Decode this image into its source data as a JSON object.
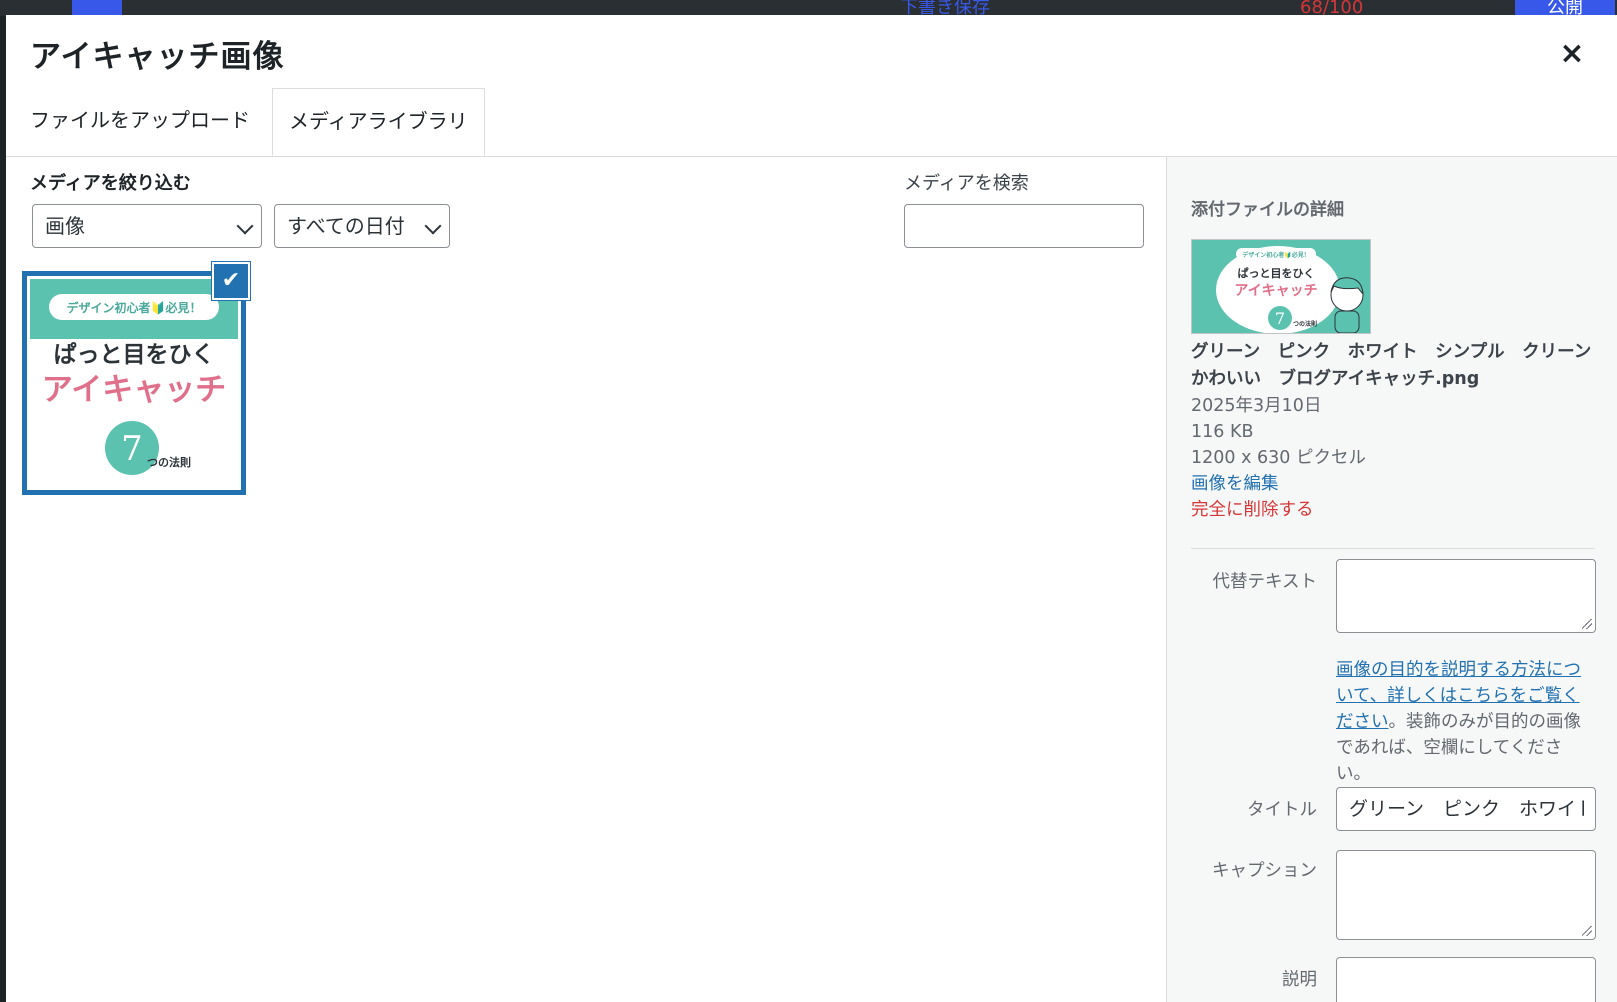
{
  "background": {
    "draft_label": "下書き保存",
    "score_label": "68/100",
    "publish_label": "公開"
  },
  "modal": {
    "title": "アイキャッチ画像",
    "close_label": "×"
  },
  "tabs": {
    "upload": "ファイルをアップロード",
    "library": "メディアライブラリ"
  },
  "filters": {
    "label": "メディアを絞り込む",
    "type_value": "画像",
    "date_value": "すべての日付",
    "search_label": "メディアを検索",
    "search_value": ""
  },
  "attachment": {
    "banner": "デザイン初心者🔰必見！",
    "line1": "ぱっと目をひく",
    "line2": "アイキャッチ",
    "number": "7",
    "suffix": "つの法則",
    "selected": true
  },
  "details": {
    "heading": "添付ファイルの詳細",
    "filename": "グリーン　ピンク　ホワイト　シンプル　クリーン　かわいい　ブログアイキャッチ.png",
    "date": "2025年3月10日",
    "size": "116 KB",
    "dimensions": "1200 x 630 ピクセル",
    "edit_link": "画像を編集",
    "delete_link": "完全に削除する"
  },
  "fields": {
    "alt_label": "代替テキスト",
    "alt_value": "",
    "alt_help_link": "画像の目的を説明する方法について、詳しくはこちらをご覧ください",
    "alt_help_text": "。装飾のみが目的の画像であれば、空欄にしてください。",
    "title_label": "タイトル",
    "title_value": "グリーン　ピンク　ホワイト　シンプル　クリーン　かわいい　ブログアイキャッチ",
    "caption_label": "キャプション",
    "caption_value": "",
    "description_label": "説明"
  },
  "colors": {
    "accent": "#2271b1",
    "danger": "#d63638",
    "teal": "#5cc2b0",
    "pink": "#e0708a"
  }
}
